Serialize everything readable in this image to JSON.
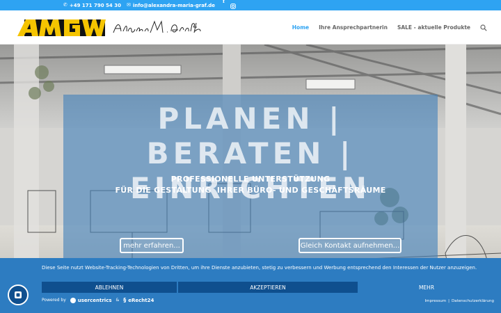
{
  "topbar": {
    "phone": "+49 171 790 54 30",
    "email": "info@alexandra-maria-graf.de",
    "social": [
      "facebook-icon",
      "instagram-icon"
    ]
  },
  "header": {
    "logo_text": "AMGW",
    "signature_text": "Alexandra M. Graf-Wenig",
    "nav": [
      {
        "label": "Home",
        "active": true
      },
      {
        "label": "Ihre Ansprechpartnerin",
        "active": false
      },
      {
        "label": "SALE - aktuelle Produkte",
        "active": false
      }
    ]
  },
  "hero": {
    "title_line1": "PLANEN | BERATEN |",
    "title_line2": "EINRICHTEN",
    "subtitle_line1": "PROFESSIONELLE UNTERSTÜTZUNG",
    "subtitle_line2": "FÜR DIE GESTALTUNG  IHRER BÜRO- UND GESCHÄFTSRÄUME",
    "button_more": "mehr erfahren...",
    "button_contact": "Gleich Kontakt aufnehmen..."
  },
  "cookie": {
    "text": "Diese Seite nutzt Website-Tracking-Technologien von Dritten, um ihre Dienste anzubieten, stetig zu verbessern und Werbung entsprechend den Interessen der Nutzer anzuzeigen.",
    "deny": "ABLEHNEN",
    "accept": "AKZEPTIEREN",
    "more": "MEHR",
    "powered_by": "Powered by",
    "brand1": "usercentrics",
    "amp": "&",
    "brand2": "eRecht24",
    "imprint": "Impressum",
    "separator": "|",
    "privacy": "Datenschutzerklärung"
  },
  "colors": {
    "accent": "#2ea3f2",
    "banner": "#2d7cc1",
    "banner_button": "#0f4f8e",
    "logo_yellow": "#f5c400"
  }
}
